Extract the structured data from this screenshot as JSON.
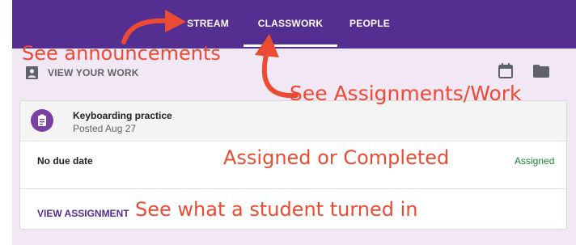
{
  "nav": {
    "tabs": [
      {
        "label": "STREAM",
        "active": false
      },
      {
        "label": "CLASSWORK",
        "active": true
      },
      {
        "label": "PEOPLE",
        "active": false
      }
    ]
  },
  "toolbar": {
    "view_work_label": "VIEW YOUR WORK",
    "icons": [
      "calendar-icon",
      "folder-icon"
    ]
  },
  "assignment": {
    "title": "Keyboarding practice",
    "posted": "Posted Aug 27",
    "due": "No due date",
    "status": "Assigned",
    "action_label": "VIEW ASSIGNMENT",
    "icon": "assignment-icon"
  },
  "annotations": {
    "announcements": "See announcements",
    "assignments": "See Assignments/Work",
    "status": "Assigned or Completed",
    "turned_in": "See what a student turned in"
  },
  "colors": {
    "header": "#542e91",
    "background": "#f1e7f5",
    "annotation": "#ec4b33",
    "status": "#188038"
  }
}
